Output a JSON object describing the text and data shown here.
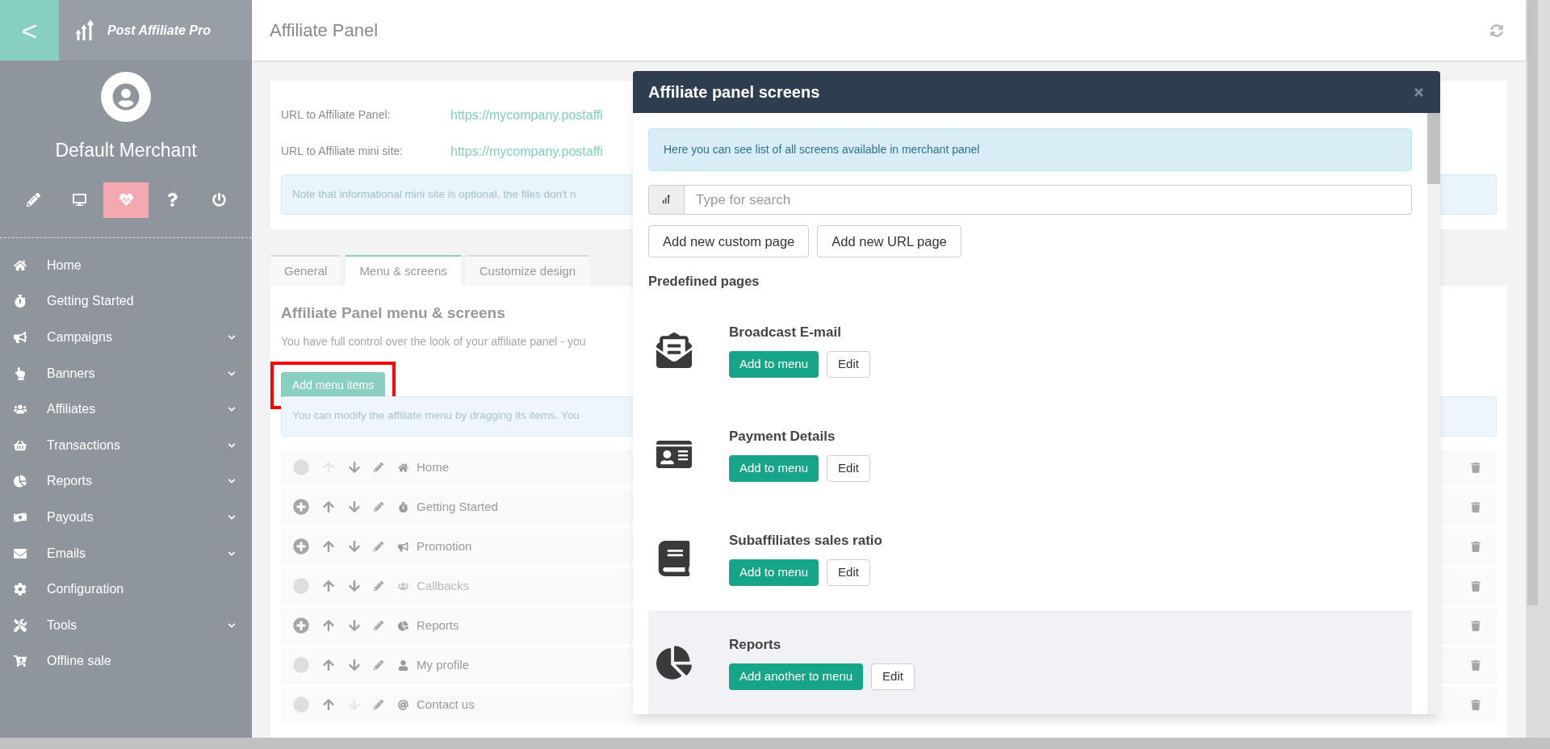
{
  "sidebar": {
    "back_button": "<",
    "brand": "Post Affiliate Pro",
    "user_name": "Default Merchant",
    "quick_actions": [
      {
        "selected": false
      },
      {
        "selected": false
      },
      {
        "selected": true
      },
      {
        "selected": false
      },
      {
        "selected": false
      }
    ],
    "items": [
      {
        "label": "Home",
        "expandable": false
      },
      {
        "label": "Getting Started",
        "expandable": false
      },
      {
        "label": "Campaigns",
        "expandable": true
      },
      {
        "label": "Banners",
        "expandable": true
      },
      {
        "label": "Affiliates",
        "expandable": true
      },
      {
        "label": "Transactions",
        "expandable": true
      },
      {
        "label": "Reports",
        "expandable": true
      },
      {
        "label": "Payouts",
        "expandable": true
      },
      {
        "label": "Emails",
        "expandable": true
      },
      {
        "label": "Configuration",
        "expandable": false
      },
      {
        "label": "Tools",
        "expandable": true
      },
      {
        "label": "Offline sale",
        "expandable": false
      }
    ]
  },
  "header": {
    "title": "Affiliate Panel"
  },
  "url_card": {
    "fields": [
      {
        "label": "URL to Affiliate Panel:",
        "value": "https://mycompany.postaffi"
      },
      {
        "label": "URL to Affiliate mini site:",
        "value": "https://mycompany.postaffi"
      }
    ],
    "note": "Note that informational mini site is optional, the files don't n"
  },
  "tabs": [
    {
      "label": "General",
      "selected": false
    },
    {
      "label": "Menu & screens",
      "selected": true
    },
    {
      "label": "Customize design",
      "selected": false
    }
  ],
  "menu_section": {
    "title": "Affiliate Panel menu & screens",
    "description": "You have full control over the look of your affiliate panel - you",
    "add_button": "Add menu items",
    "hint": "You can modify the affiliate menu by dragging its items. You",
    "rows": [
      {
        "label": "Home",
        "addable": false,
        "up_enabled": false,
        "down_enabled": true,
        "disabled": false
      },
      {
        "label": "Getting Started",
        "addable": true,
        "up_enabled": true,
        "down_enabled": true,
        "disabled": false
      },
      {
        "label": "Promotion",
        "addable": true,
        "up_enabled": true,
        "down_enabled": true,
        "disabled": false
      },
      {
        "label": "Callbacks",
        "addable": false,
        "up_enabled": true,
        "down_enabled": true,
        "disabled": true
      },
      {
        "label": "Reports",
        "addable": true,
        "up_enabled": true,
        "down_enabled": true,
        "disabled": false
      },
      {
        "label": "My profile",
        "addable": false,
        "up_enabled": true,
        "down_enabled": true,
        "disabled": false
      },
      {
        "label": "Contact us",
        "addable": false,
        "up_enabled": true,
        "down_enabled": false,
        "disabled": false
      }
    ]
  },
  "modal": {
    "title": "Affiliate panel screens",
    "info": "Here you can see list of all screens available in merchant panel",
    "search": {
      "placeholder": "Type for search"
    },
    "buttons": [
      "Add new custom page",
      "Add new URL page"
    ],
    "section_title": "Predefined pages",
    "pages": [
      {
        "title": "Broadcast E-mail",
        "add_button": "Add to menu",
        "edit_button": "Edit",
        "highlighted": false
      },
      {
        "title": "Payment Details",
        "add_button": "Add to menu",
        "edit_button": "Edit",
        "highlighted": false
      },
      {
        "title": "Subaffiliates sales ratio",
        "add_button": "Add to menu",
        "edit_button": "Edit",
        "highlighted": false
      },
      {
        "title": "Reports",
        "add_button": "Add another to menu",
        "edit_button": "Edit",
        "highlighted": true
      }
    ]
  }
}
